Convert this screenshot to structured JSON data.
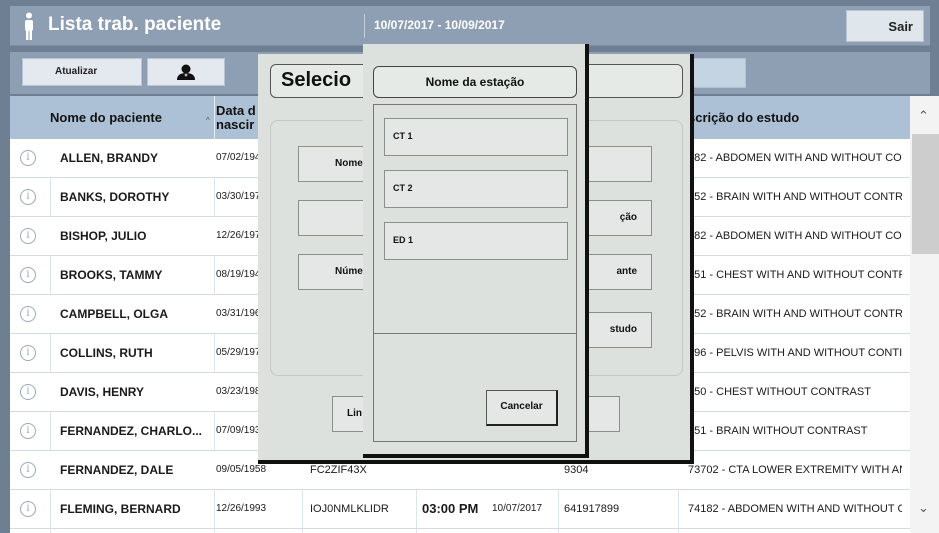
{
  "header": {
    "title": "Lista trab. paciente",
    "date_range": "10/07/2017  -  10/09/2017",
    "exit_label": "Sair"
  },
  "toolbar": {
    "refresh_label": "Atualizar",
    "doctor_icon": "doctor-icon"
  },
  "table": {
    "headers": {
      "name": "Nome do paciente",
      "sort_arrow": "^",
      "birth": [
        "Data d",
        "nascir"
      ],
      "description": "scrição do estudo"
    },
    "rows": [
      {
        "name": "ALLEN, BRANDY",
        "birth": "07/02/194",
        "mrn": "",
        "time": "",
        "date": "",
        "accession": "",
        "description": "182 - ABDOMEN WITH AND WITHOUT CO"
      },
      {
        "name": "BANKS, DOROTHY",
        "birth": "03/30/197",
        "mrn": "",
        "time": "",
        "date": "",
        "accession": "",
        "description": "552 - BRAIN WITH AND WITHOUT CONTR"
      },
      {
        "name": "BISHOP, JULIO",
        "birth": "12/26/197",
        "mrn": "",
        "time": "",
        "date": "",
        "accession": "",
        "description": "182 - ABDOMEN WITH AND WITHOUT CO"
      },
      {
        "name": "BROOKS, TAMMY",
        "birth": "08/19/194",
        "mrn": "",
        "time": "",
        "date": "",
        "accession": "",
        "description": "551 - CHEST WITH AND WITHOUT CONTF"
      },
      {
        "name": "CAMPBELL, OLGA",
        "birth": "03/31/196",
        "mrn": "",
        "time": "",
        "date": "",
        "accession": "",
        "description": "552 - BRAIN WITH AND WITHOUT CONTR"
      },
      {
        "name": "COLLINS, RUTH",
        "birth": "05/29/197",
        "mrn": "",
        "time": "",
        "date": "",
        "accession": "",
        "description": "196 - PELVIS WITH AND WITHOUT CONTI"
      },
      {
        "name": "DAVIS, HENRY",
        "birth": "03/23/198",
        "mrn": "",
        "time": "",
        "date": "",
        "accession": "",
        "description": "550 - CHEST WITHOUT CONTRAST"
      },
      {
        "name": "FERNANDEZ, CHARLO...",
        "birth": "07/09/193",
        "mrn": "",
        "time": "",
        "date": "",
        "accession": "",
        "description": "551 - BRAIN WITHOUT CONTRAST"
      },
      {
        "name": "FERNANDEZ, DALE",
        "birth": "09/05/1958",
        "mrn": "FC2ZIF43X",
        "time": "",
        "date": "",
        "accession": "9304",
        "description": "73702 - CTA LOWER EXTREMITY WITH ANE"
      },
      {
        "name": "FLEMING, BERNARD",
        "birth": "12/26/1993",
        "mrn": "IOJ0NMLKLIDR",
        "time": "03:00 PM",
        "date": "10/07/2017",
        "accession": "641917899",
        "description": "74182 - ABDOMEN WITH AND WITHOUT CO"
      }
    ]
  },
  "dialog_back": {
    "title": "Selecio",
    "buttons": [
      {
        "label": "Nome",
        "side": "left"
      },
      {
        "label": "",
        "side": "left"
      },
      {
        "label": "Núme",
        "side": "left"
      },
      {
        "label": "",
        "side": "right"
      },
      {
        "label": "ção",
        "side": "right"
      },
      {
        "label": "ante",
        "side": "right"
      },
      {
        "label": "studo",
        "side": "right"
      }
    ],
    "bottom_left_label": "Lin"
  },
  "dialog_front": {
    "title": "Nome da estação",
    "stations": [
      "CT 1",
      "CT 2",
      "ED 1"
    ],
    "cancel_label": "Cancelar"
  }
}
